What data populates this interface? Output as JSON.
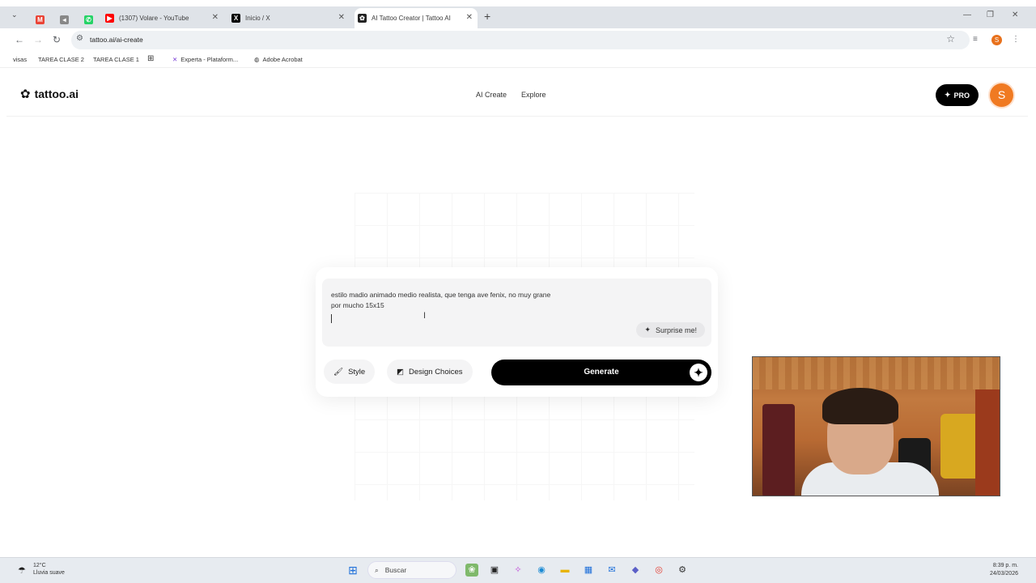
{
  "browser": {
    "tabs": [
      {
        "title": "(1307) Volare - YouTube",
        "favicon": "youtube-icon",
        "color": "#ff0000"
      },
      {
        "title": "Inicio / X",
        "favicon": "x-icon",
        "color": "#000000"
      },
      {
        "title": "AI Tattoo Creator | Tattoo AI",
        "favicon": "tattoo-icon",
        "color": "#222222",
        "active": true
      }
    ],
    "url": "tattoo.ai/ai-create",
    "profile_initial": "S",
    "bookmarks": [
      "visas",
      "TAREA CLASE 2",
      "TAREA CLASE 1",
      "Experta - Plataform...",
      "Adobe Acrobat"
    ]
  },
  "site": {
    "logo_text": "tattoo.ai",
    "nav": [
      "AI Create",
      "Explore"
    ],
    "pro_label": "PRO",
    "user_initial": "S",
    "accent": "#f07a22"
  },
  "creator": {
    "prompt_text": "estilo madio animado medio realista, que tenga ave fenix, no muy grane\npor mucho 15x15",
    "surprise_label": "Surprise me!",
    "style_label": "Style",
    "design_choices_label": "Design Choices",
    "generate_label": "Generate"
  },
  "taskbar": {
    "temperature": "12°C",
    "weather": "Lluvia suave",
    "search_label": "Buscar",
    "time": "8:39 p. m.",
    "date": "24/03/2026"
  }
}
